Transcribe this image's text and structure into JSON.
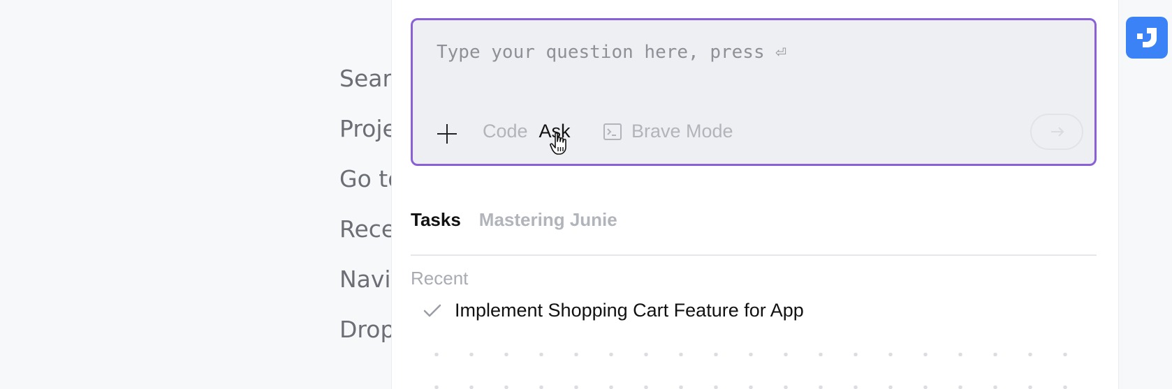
{
  "background_menu": {
    "items": [
      "Search Everywhere",
      "Project View",
      "Go to File",
      "Recent Files",
      "Navigation Bar",
      "Drop files here to open them"
    ]
  },
  "prompt": {
    "placeholder": "Type your question here, press ⏎",
    "value": ""
  },
  "mode": {
    "code_label": "Code",
    "ask_label": "Ask",
    "selected": "Ask"
  },
  "brave_mode": {
    "label": "Brave Mode",
    "icon": "terminal-icon"
  },
  "icons": {
    "add": "plus-icon",
    "send": "arrow-right-icon",
    "task_status": "check-icon",
    "app": "junie-icon",
    "cursor": "hand-pointer-icon"
  },
  "tabs": [
    {
      "label": "Tasks",
      "active": true
    },
    {
      "label": "Mastering Junie",
      "active": false
    }
  ],
  "recent": {
    "label": "Recent",
    "tasks": [
      {
        "title": "Implement Shopping Cart Feature for App",
        "status": "done"
      }
    ]
  },
  "colors": {
    "accent_border": "#8a60d6",
    "app_icon_bg": "#3b82f6",
    "muted_text": "#b1b4ba"
  }
}
